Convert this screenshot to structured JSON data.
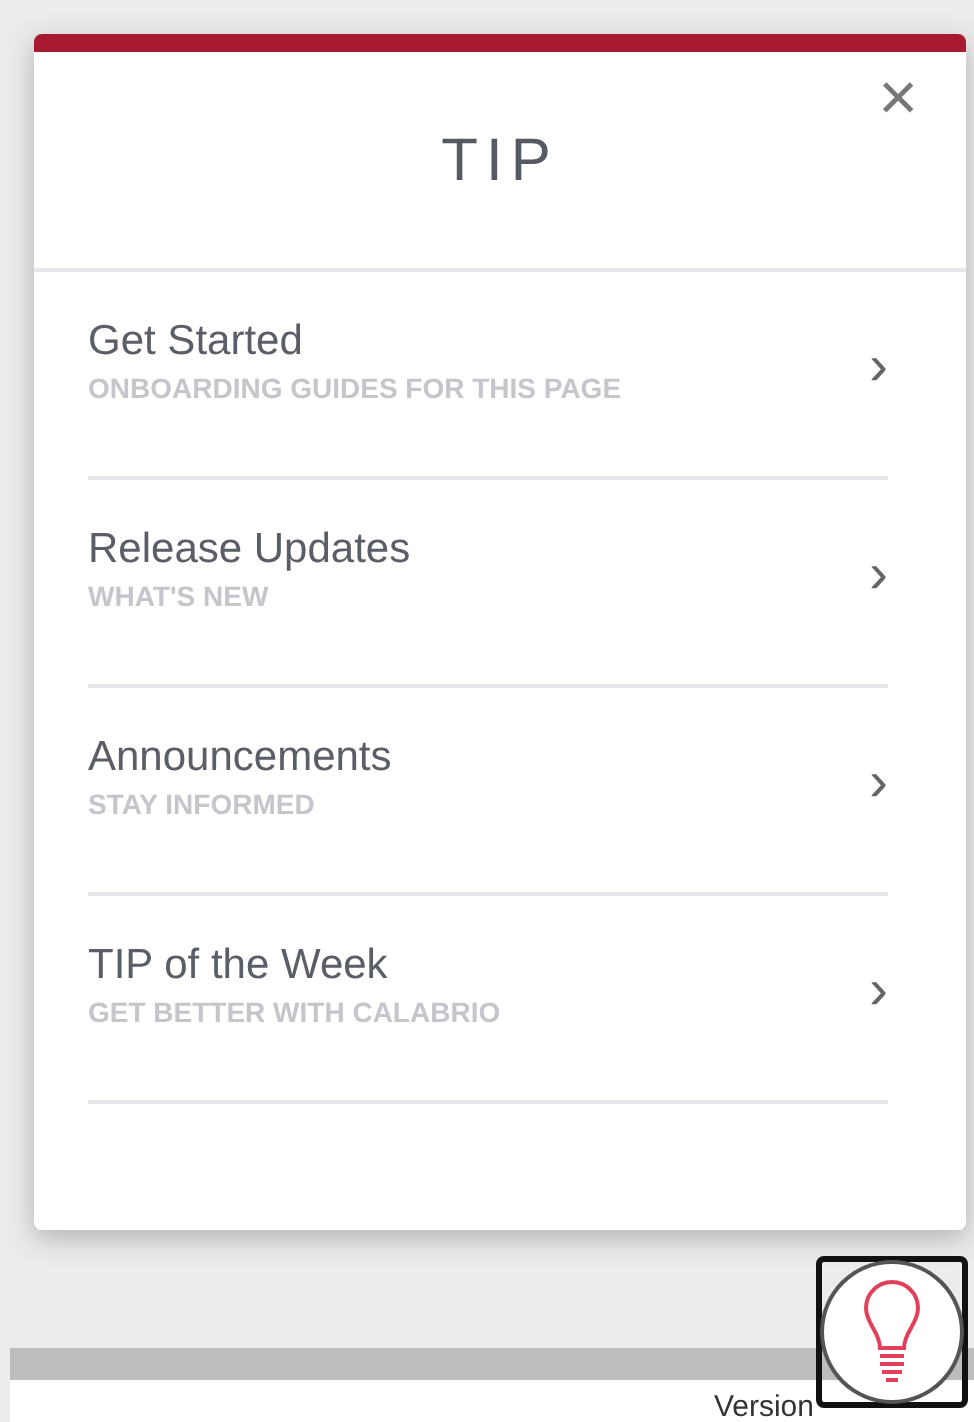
{
  "dialog": {
    "title": "TIP",
    "close": "×",
    "items": [
      {
        "title": "Get Started",
        "subtitle": "ONBOARDING GUIDES FOR THIS PAGE",
        "chevron": "›"
      },
      {
        "title": "Release Updates",
        "subtitle": "WHAT'S NEW",
        "chevron": "›"
      },
      {
        "title": "Announcements",
        "subtitle": "STAY INFORMED",
        "chevron": "›"
      },
      {
        "title": "TIP of the Week",
        "subtitle": "GET BETTER WITH CALABRIO",
        "chevron": "›"
      }
    ]
  },
  "footer": {
    "version": "Version"
  }
}
